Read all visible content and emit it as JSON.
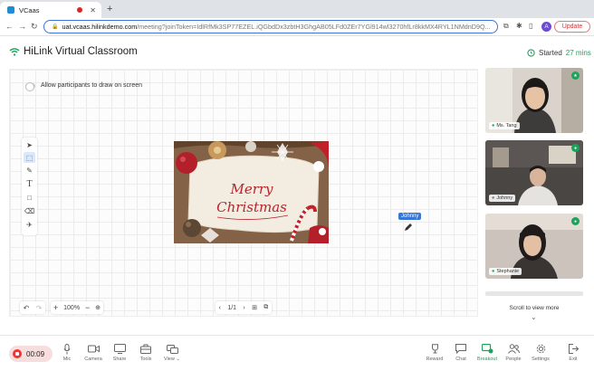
{
  "browser": {
    "tab_title": "VCaas",
    "url_host": "uat.vcaas.hilinkdemo.com",
    "url_rest": "/meeting?joinToken=IdlRfMk3SP77EZEL.iQGbdDx3zbtH3GhgAB05LFd0ZEr7YGl914wl3270hfLr8kkMX4RYL1NMdnD9Q...",
    "avatar_letter": "A",
    "update_label": "Update",
    "colors": {
      "accent": "#3b73d9",
      "update": "#c73a3a"
    }
  },
  "app": {
    "title": "HiLink Virtual Classroom",
    "started_label": "Started",
    "started_minutes": "27 mins",
    "brand_color": "#19a35b"
  },
  "board": {
    "allow_draw_label": "Allow participants to draw on screen",
    "allow_draw_enabled": false,
    "card_text_line1": "Merry",
    "card_text_line2": "Christmas",
    "cursor_user": "Johnny",
    "zoom": "100%",
    "page": "1/1"
  },
  "participants": [
    {
      "name": "Ms. Tang"
    },
    {
      "name": "Johnny"
    },
    {
      "name": "Stephanie"
    }
  ],
  "scroll_more_label": "Scroll to view more",
  "bottom": {
    "timer": "00:09",
    "buttons": [
      "Mic",
      "Camera",
      "Share",
      "Tools",
      "View",
      "Reward",
      "Chat",
      "Breakout",
      "People",
      "Settings",
      "Exit"
    ]
  }
}
